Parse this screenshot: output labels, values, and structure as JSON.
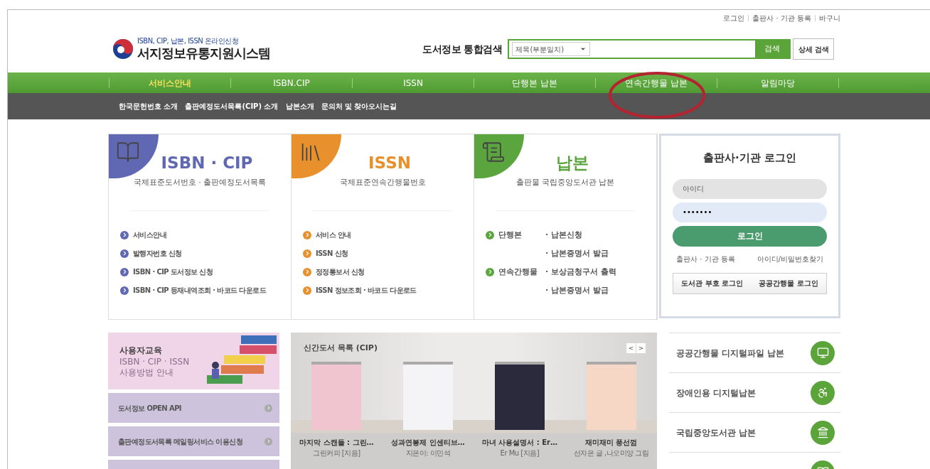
{
  "top_links": [
    "로그인",
    "출판사 · 기관 등록",
    "바구니"
  ],
  "logo": {
    "tagline": "ISBN, CIP, 납본, ISSN 온라인신청",
    "title": "서지정보유통지원시스템"
  },
  "search": {
    "label": "도서정보 통합검색",
    "scope": "제목(부분일치)",
    "button": "검색",
    "advanced": "상세 검색"
  },
  "nav": [
    {
      "label": "서비스안내",
      "selected": true,
      "highlighted": false
    },
    {
      "label": "ISBN.CIP",
      "selected": false,
      "highlighted": false
    },
    {
      "label": "ISSN",
      "selected": false,
      "highlighted": false
    },
    {
      "label": "단행본 납본",
      "selected": false,
      "highlighted": false
    },
    {
      "label": "연속간행물 납본",
      "selected": false,
      "highlighted": true
    },
    {
      "label": "알림마당",
      "selected": false,
      "highlighted": false
    }
  ],
  "sub_nav": [
    "한국문헌번호 소개",
    "출판예정도서목록(CIP) 소개",
    "납본소개",
    "문의처 및 찾아오시는길"
  ],
  "service_cards": [
    {
      "kind": "list",
      "title": "ISBN · CIP",
      "subtitle": "국제표준도서번호 · 출판예정도서목록",
      "color": "#6068b4",
      "links": [
        "서비스안내",
        "발행자번호 신청",
        "ISBN · CIP 도서정보 신청",
        "ISBN · CIP 등재내역조회 · 바코드 다운로드"
      ]
    },
    {
      "kind": "list",
      "title": "ISSN",
      "subtitle": "국제표준연속간행물번호",
      "color": "#e8912c",
      "links": [
        "서비스 안내",
        "ISSN 신청",
        "정정통보서 신청",
        "ISSN 정보조회 · 바코드 다운로드"
      ]
    },
    {
      "kind": "groups",
      "title": "납본",
      "subtitle": "출판물 국립중앙도서관  납본",
      "color": "#5ba53f",
      "groups": [
        {
          "label": "단행본",
          "links": [
            "· 납본신청",
            "· 납본증명서 발급"
          ]
        },
        {
          "label": "연속간행물",
          "links": [
            "· 보상금청구서 출력",
            "· 납본증명서 발급"
          ]
        }
      ]
    }
  ],
  "login": {
    "title": "출판사·기관 로그인",
    "id_placeholder": "아이디",
    "password_value": "•••••••",
    "button": "로그인",
    "links": [
      "출판사 · 기관 등록",
      "아이디/비밀번호찾기"
    ],
    "alt_buttons": [
      "도서관 부호 로그인",
      "공공간행물 로그인"
    ]
  },
  "education": {
    "title": "사용자교육",
    "lines": [
      "ISBN · CIP · ISSN",
      "사용방법 안내"
    ]
  },
  "side_links": [
    "도서정보 OPEN API",
    "출판예정도서목록 메일링서비스 이용신청"
  ],
  "new_books": {
    "title": "신간도서 목록 (CIP)",
    "prev": "<",
    "next": ">",
    "books": [
      {
        "title": "마지막 스캔들 : 그린…",
        "author": "그린커피 [지음]"
      },
      {
        "title": "성과연봉제 인센티브…",
        "author": "지은이: 이민석"
      },
      {
        "title": "마녀 사용설명서 : Er…",
        "author": "Er Mu [지음]"
      },
      {
        "title": "재미재미 풍선껌",
        "author": "선자은 글 ,나오미양 그림"
      }
    ]
  },
  "quick_links": [
    "공공간행물 디지털파일 납본",
    "장애인용 디지털납본",
    "국립중앙도서관 납본"
  ]
}
